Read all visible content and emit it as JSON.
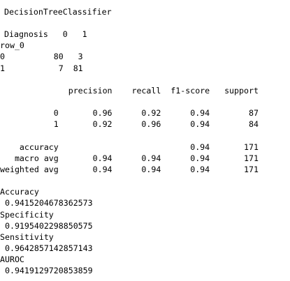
{
  "output": {
    "title": "DecisionTreeClassifier",
    "crosstab": {
      "header": "Diagnosis   0   1",
      "index_label": "row_0",
      "rows": [
        "0          80   3",
        "1           7  81"
      ]
    },
    "report": {
      "header": "              precision    recall  f1-score   support",
      "rows": [
        "           0       0.96      0.92      0.94        87",
        "           1       0.92      0.96      0.94        84"
      ],
      "summary": [
        "    accuracy                           0.94       171",
        "   macro avg       0.94      0.94      0.94       171",
        "weighted avg       0.94      0.94      0.94       171"
      ]
    },
    "metrics": [
      {
        "label": "Accuracy",
        "value": " 0.9415204678362573"
      },
      {
        "label": "Specificity",
        "value": " 0.9195402298850575"
      },
      {
        "label": "Sensitivity",
        "value": " 0.9642857142857143"
      },
      {
        "label": "AUROC",
        "value": " 0.9419129720853859"
      }
    ]
  }
}
